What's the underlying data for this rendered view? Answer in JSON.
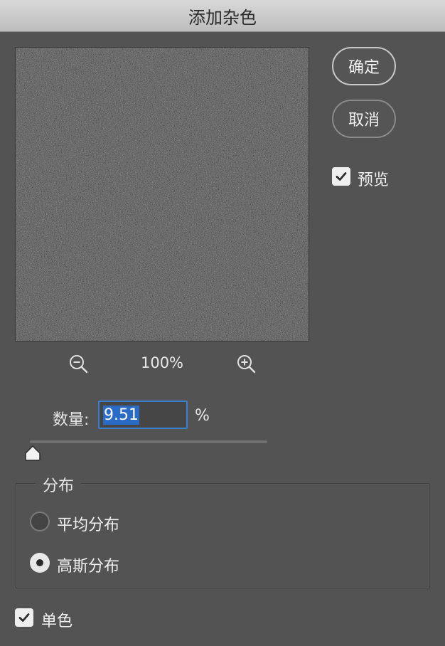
{
  "window": {
    "title": "添加杂色"
  },
  "buttons": {
    "ok_label": "确定",
    "cancel_label": "取消"
  },
  "preview_checkbox": {
    "label": "预览",
    "checked": true
  },
  "zoom": {
    "level": "100%",
    "zoom_out_icon": "zoom-out-magnifier-icon",
    "zoom_in_icon": "zoom-in-magnifier-icon"
  },
  "amount": {
    "label": "数量:",
    "value": "9.51",
    "unit": "%",
    "slider_fraction": 0.0095
  },
  "distribution": {
    "legend": "分布",
    "options": [
      {
        "label": "平均分布",
        "selected": false
      },
      {
        "label": "高斯分布",
        "selected": true
      }
    ]
  },
  "monochromatic": {
    "label": "单色",
    "checked": true
  },
  "colors": {
    "background": "#535353",
    "accent": "#2a6bc6",
    "titlebar": "#c8c8c8"
  }
}
